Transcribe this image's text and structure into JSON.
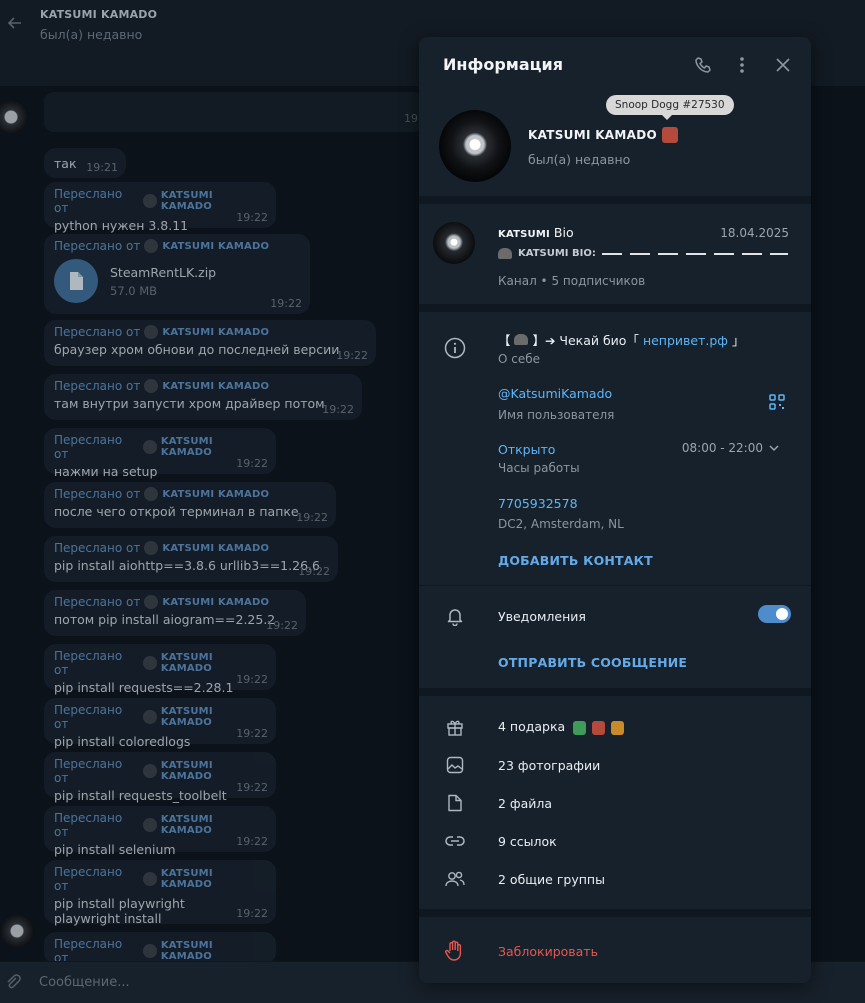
{
  "chat": {
    "title": "KATSUMI KAMADO",
    "status": "был(а) недавно",
    "composer_placeholder": "Сообщение...",
    "date_fragment": "19",
    "messages": [
      {
        "forwarded": false,
        "text": "так",
        "time": "19:21"
      },
      {
        "forwarded": true,
        "fwd_label": "Переслано от",
        "fwd_name": "KATSUMI KAMADO",
        "text": "python нужен 3.8.11",
        "time": "19:22"
      },
      {
        "forwarded": true,
        "fwd_label": "Переслано от",
        "fwd_name": "KATSUMI KAMADO",
        "file_name": "SteamRentLK.zip",
        "file_size": "57.0 MB",
        "time": "19:22"
      },
      {
        "forwarded": true,
        "fwd_label": "Переслано от",
        "fwd_name": "KATSUMI KAMADO",
        "text": "браузер хром обнови до последней версии",
        "time": "19:22"
      },
      {
        "forwarded": true,
        "fwd_label": "Переслано от",
        "fwd_name": "KATSUMI KAMADO",
        "text": "там внутри запусти хром драйвер потом",
        "time": "19:22"
      },
      {
        "forwarded": true,
        "fwd_label": "Переслано от",
        "fwd_name": "KATSUMI KAMADO",
        "text": "нажми на setup",
        "time": "19:22"
      },
      {
        "forwarded": true,
        "fwd_label": "Переслано от",
        "fwd_name": "KATSUMI KAMADO",
        "text": "после чего открой терминал в папке",
        "time": "19:22"
      },
      {
        "forwarded": true,
        "fwd_label": "Переслано от",
        "fwd_name": "KATSUMI KAMADO",
        "text": "pip install aiohttp==3.8.6 urllib3==1.26.6",
        "time": "19:22"
      },
      {
        "forwarded": true,
        "fwd_label": "Переслано от",
        "fwd_name": "KATSUMI KAMADO",
        "text": "потом pip install aiogram==2.25.2",
        "time": "19:22"
      },
      {
        "forwarded": true,
        "fwd_label": "Переслано от",
        "fwd_name": "KATSUMI KAMADO",
        "text": "pip install requests==2.28.1",
        "time": "19:22"
      },
      {
        "forwarded": true,
        "fwd_label": "Переслано от",
        "fwd_name": "KATSUMI KAMADO",
        "text": "pip install coloredlogs",
        "time": "19:22"
      },
      {
        "forwarded": true,
        "fwd_label": "Переслано от",
        "fwd_name": "KATSUMI KAMADO",
        "text": "pip install requests_toolbelt",
        "time": "19:22"
      },
      {
        "forwarded": true,
        "fwd_label": "Переслано от",
        "fwd_name": "KATSUMI KAMADO",
        "text": "pip install selenium",
        "time": "19:22"
      },
      {
        "forwarded": true,
        "fwd_label": "Переслано от",
        "fwd_name": "KATSUMI KAMADO",
        "text": "pip install playwright",
        "text2": "playwright install",
        "time": "19:22"
      },
      {
        "forwarded": true,
        "fwd_label": "Переслано от",
        "fwd_name": "KATSUMI KAMADO",
        "text": "",
        "time": ""
      }
    ]
  },
  "panel": {
    "title": "Информация",
    "tooltip": "Snoop Dogg #27530",
    "profile_name": "KATSUMI KAMADO",
    "profile_status": "был(а) недавно",
    "channel": {
      "title_bold": "KATSUMI",
      "title_rest": " Bio",
      "date": "18.04.2025",
      "preview": "KATSUMI BIO:",
      "subtitle": "Канал • 5 подписчиков"
    },
    "bio": {
      "prefix": "【 ",
      "mid": " 】➔ Чекай био「 ",
      "link": "непривет.рф",
      "suffix": " 」",
      "label": "О себе"
    },
    "username": {
      "value": "@KatsumiKamado",
      "label": "Имя пользователя"
    },
    "hours": {
      "value": "Открыто",
      "label": "Часы работы",
      "range": "08:00 - 22:00"
    },
    "phone": {
      "value": "7705932578",
      "label": "DC2, Amsterdam, NL"
    },
    "add_contact": "ДОБАВИТЬ КОНТАКТ",
    "notifications": {
      "label": "Уведомления",
      "enabled": true
    },
    "send_message": "ОТПРАВИТЬ СООБЩЕНИЕ",
    "media": [
      {
        "icon": "gift-icon",
        "label": "4 подарка"
      },
      {
        "icon": "photo-icon",
        "label": "23 фотографии"
      },
      {
        "icon": "file-icon",
        "label": "2 файла"
      },
      {
        "icon": "link-icon",
        "label": "9 ссылок"
      },
      {
        "icon": "groups-icon",
        "label": "2 общие группы"
      }
    ],
    "block": "Заблокировать"
  },
  "colors": {
    "accent": "#5eb5f7",
    "danger": "#e8574f",
    "panel_bg": "#17212b",
    "toggle_on": "#4e8ccc"
  }
}
